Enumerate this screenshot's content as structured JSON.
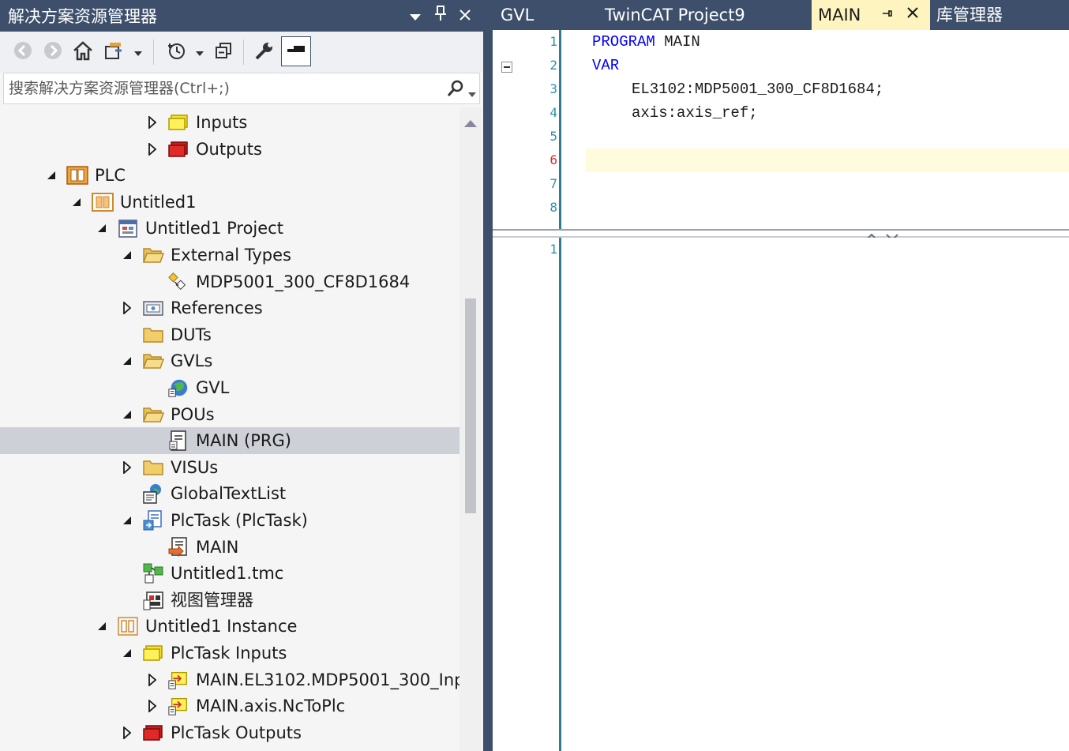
{
  "solution_explorer": {
    "title": "解决方案资源管理器",
    "search": {
      "placeholder": "搜索解决方案资源管理器(Ctrl+;)"
    },
    "tree": [
      {
        "label": "Inputs",
        "depth": 5,
        "expander": "collapsed",
        "icon": "inputs-icon"
      },
      {
        "label": "Outputs",
        "depth": 5,
        "expander": "collapsed",
        "icon": "outputs-icon"
      },
      {
        "label": "PLC",
        "depth": 1,
        "expander": "expanded",
        "icon": "plc-icon"
      },
      {
        "label": "Untitled1",
        "depth": 2,
        "expander": "expanded",
        "icon": "plc-project-icon"
      },
      {
        "label": "Untitled1 Project",
        "depth": 3,
        "expander": "expanded",
        "icon": "project-icon"
      },
      {
        "label": "External Types",
        "depth": 4,
        "expander": "expanded",
        "icon": "folder-open-icon"
      },
      {
        "label": "MDP5001_300_CF8D1684",
        "depth": 5,
        "expander": "none",
        "icon": "external-type-icon"
      },
      {
        "label": "References",
        "depth": 4,
        "expander": "collapsed",
        "icon": "references-icon"
      },
      {
        "label": "DUTs",
        "depth": 4,
        "expander": "none",
        "icon": "folder-icon"
      },
      {
        "label": "GVLs",
        "depth": 4,
        "expander": "expanded",
        "icon": "folder-open-icon"
      },
      {
        "label": "GVL",
        "depth": 5,
        "expander": "none",
        "icon": "gvl-globe-icon"
      },
      {
        "label": "POUs",
        "depth": 4,
        "expander": "expanded",
        "icon": "folder-open-icon"
      },
      {
        "label": "MAIN (PRG)",
        "depth": 5,
        "expander": "none",
        "icon": "pou-program-icon",
        "selected": true
      },
      {
        "label": "VISUs",
        "depth": 4,
        "expander": "collapsed",
        "icon": "folder-icon"
      },
      {
        "label": "GlobalTextList",
        "depth": 4,
        "expander": "none",
        "icon": "text-list-icon"
      },
      {
        "label": "PlcTask (PlcTask)",
        "depth": 4,
        "expander": "expanded",
        "icon": "task-icon"
      },
      {
        "label": "MAIN",
        "depth": 5,
        "expander": "none",
        "icon": "task-program-call-icon"
      },
      {
        "label": "Untitled1.tmc",
        "depth": 4,
        "expander": "none",
        "icon": "tmc-icon"
      },
      {
        "label": "视图管理器",
        "depth": 4,
        "expander": "none",
        "icon": "view-manager-icon"
      },
      {
        "label": "Untitled1 Instance",
        "depth": 3,
        "expander": "expanded",
        "icon": "instance-icon"
      },
      {
        "label": "PlcTask Inputs",
        "depth": 4,
        "expander": "expanded",
        "icon": "inputs-icon"
      },
      {
        "label": "MAIN.EL3102.MDP5001_300_Inp",
        "depth": 5,
        "expander": "collapsed",
        "icon": "input-variable-icon"
      },
      {
        "label": "MAIN.axis.NcToPlc",
        "depth": 5,
        "expander": "collapsed",
        "icon": "input-variable-icon"
      },
      {
        "label": "PlcTask Outputs",
        "depth": 4,
        "expander": "collapsed",
        "icon": "outputs-icon"
      }
    ]
  },
  "editor": {
    "tabs": [
      {
        "label": "GVL",
        "active": false
      },
      {
        "label": "TwinCAT Project9",
        "active": false
      },
      {
        "label": "MAIN",
        "active": true
      },
      {
        "label": "库管理器",
        "active": false
      }
    ],
    "declaration": {
      "line_numbers": [
        "1",
        "2",
        "3",
        "4",
        "5",
        "6",
        "7",
        "8"
      ],
      "current_line": 6,
      "lines": [
        {
          "keyword": "PROGRAM",
          "rest": " MAIN",
          "indent": 0
        },
        {
          "keyword": "VAR",
          "rest": "",
          "indent": 0
        },
        {
          "keyword": "",
          "rest": "EL3102:MDP5001_300_CF8D1684;",
          "indent": 4
        },
        {
          "keyword": "",
          "rest": "axis:axis_ref;",
          "indent": 4
        }
      ]
    },
    "implementation": {
      "line_numbers": [
        "1"
      ]
    }
  },
  "colors": {
    "titlebar": "#3d4f6b",
    "active_tab": "#fdf4bf",
    "selection": "#cdd0d6",
    "keyword": "#0000ff",
    "line_number": "#2b91af",
    "current_line_number": "#cc3333"
  }
}
